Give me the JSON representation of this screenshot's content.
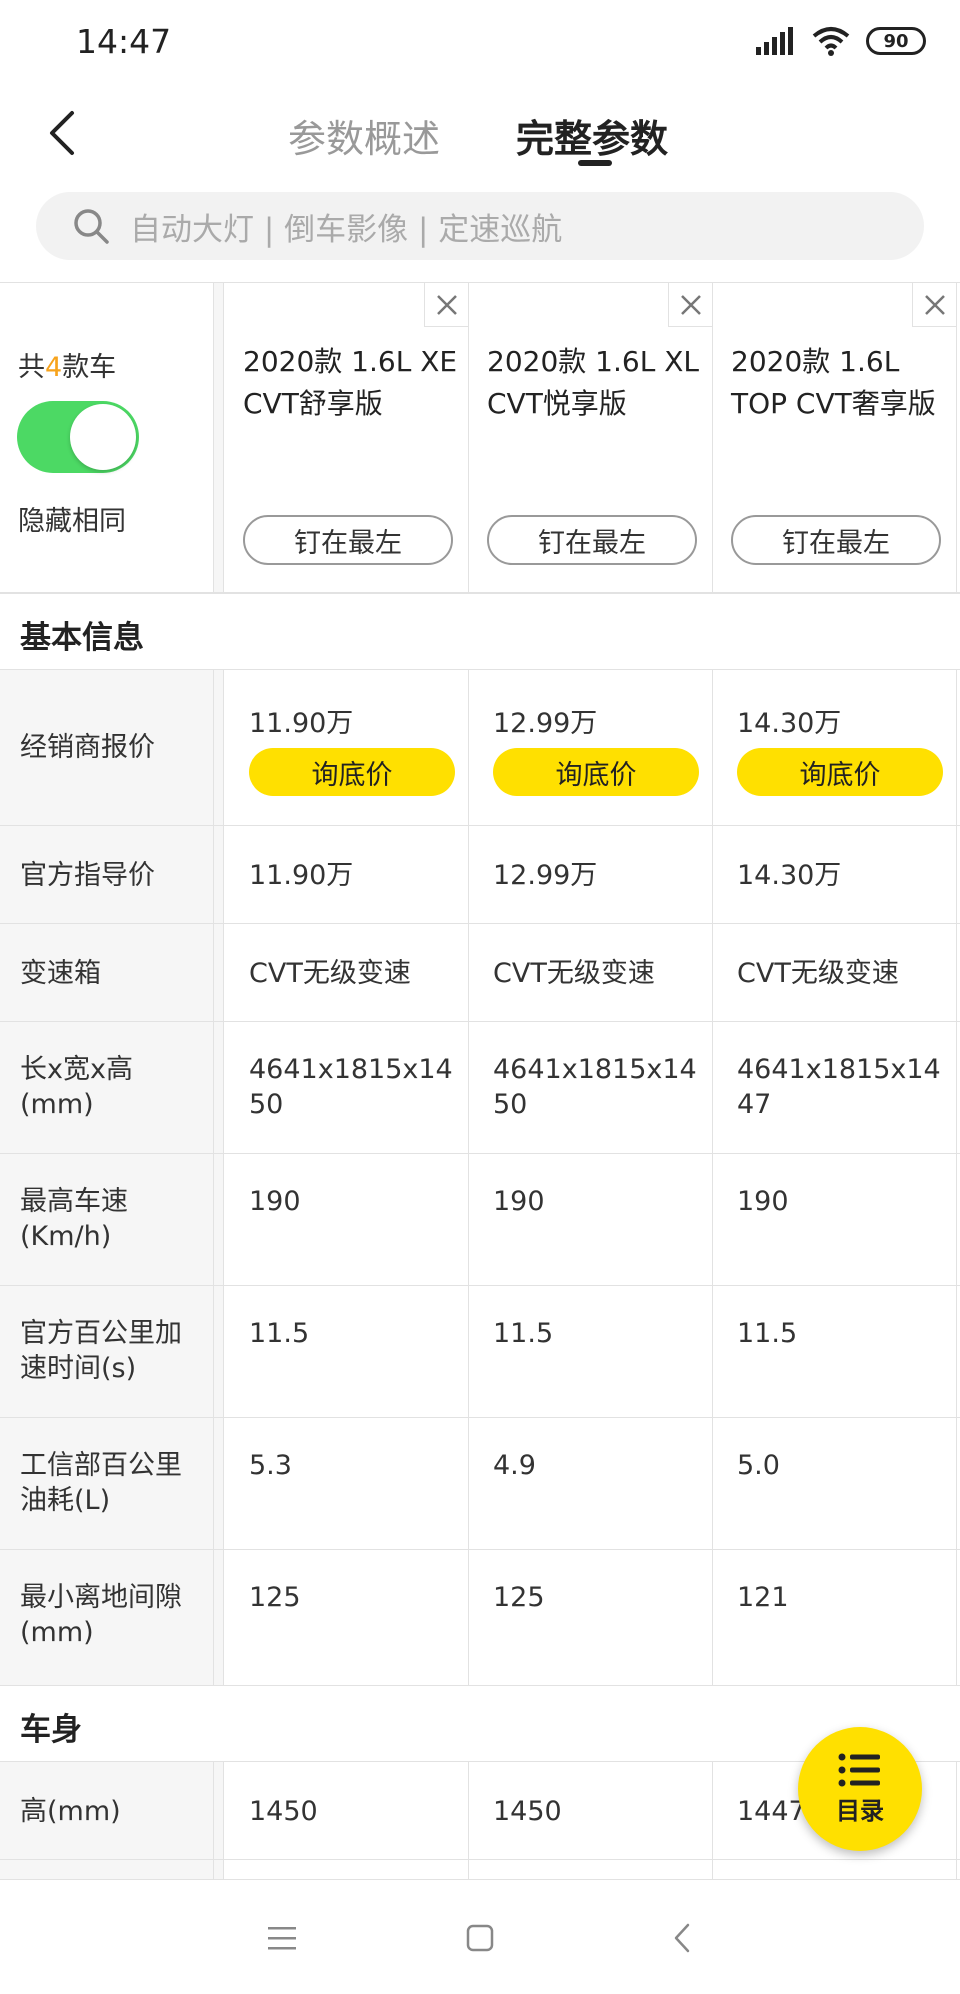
{
  "status_bar": {
    "time": "14:47",
    "battery": "90"
  },
  "header": {
    "tabs": [
      {
        "label": "参数概述",
        "active": false
      },
      {
        "label": "完整参数",
        "active": true
      }
    ]
  },
  "search": {
    "placeholder": "自动大灯 | 倒车影像 | 定速巡航"
  },
  "compare": {
    "count_prefix": "共",
    "count_num": "4",
    "count_suffix": "款车",
    "hide_same_label": "隐藏相同",
    "hide_same_on": true,
    "pin_label": "钉在最左",
    "cars": [
      {
        "name": "2020款 1.6L XE CVT舒享版"
      },
      {
        "name": "2020款 1.6L XL CVT悦享版"
      },
      {
        "name": "2020款 1.6L TOP CVT奢享版"
      }
    ]
  },
  "sections": {
    "basic_title": "基本信息",
    "body_title": "车身"
  },
  "rows": {
    "dealer_price": {
      "label": "经销商报价",
      "values": [
        "11.90万",
        "12.99万",
        "14.30万"
      ],
      "button": "询底价"
    },
    "msrp": {
      "label": "官方指导价",
      "values": [
        "11.90万",
        "12.99万",
        "14.30万"
      ]
    },
    "gearbox": {
      "label": "变速箱",
      "values": [
        "CVT无级变速",
        "CVT无级变速",
        "CVT无级变速"
      ]
    },
    "dimensions": {
      "label": "长x宽x高(mm)",
      "values": [
        "4641x1815x1450",
        "4641x1815x1450",
        "4641x1815x1447"
      ]
    },
    "top_speed": {
      "label": "最高车速(Km/h)",
      "values": [
        "190",
        "190",
        "190"
      ]
    },
    "acceleration": {
      "label": "官方百公里加速时间(s)",
      "values": [
        "11.5",
        "11.5",
        "11.5"
      ]
    },
    "fuel": {
      "label": "工信部百公里油耗(L)",
      "values": [
        "5.3",
        "4.9",
        "5.0"
      ]
    },
    "clearance": {
      "label": "最小离地间隙(mm)",
      "values": [
        "125",
        "125",
        "121"
      ]
    },
    "height": {
      "label": "高(mm)",
      "values": [
        "1450",
        "1450",
        "1447"
      ]
    }
  },
  "catalog_button": {
    "label": "目录"
  },
  "colors": {
    "accent_yellow": "#ffe000",
    "toggle_green": "#4cd964",
    "count_orange": "#f7a31c"
  }
}
